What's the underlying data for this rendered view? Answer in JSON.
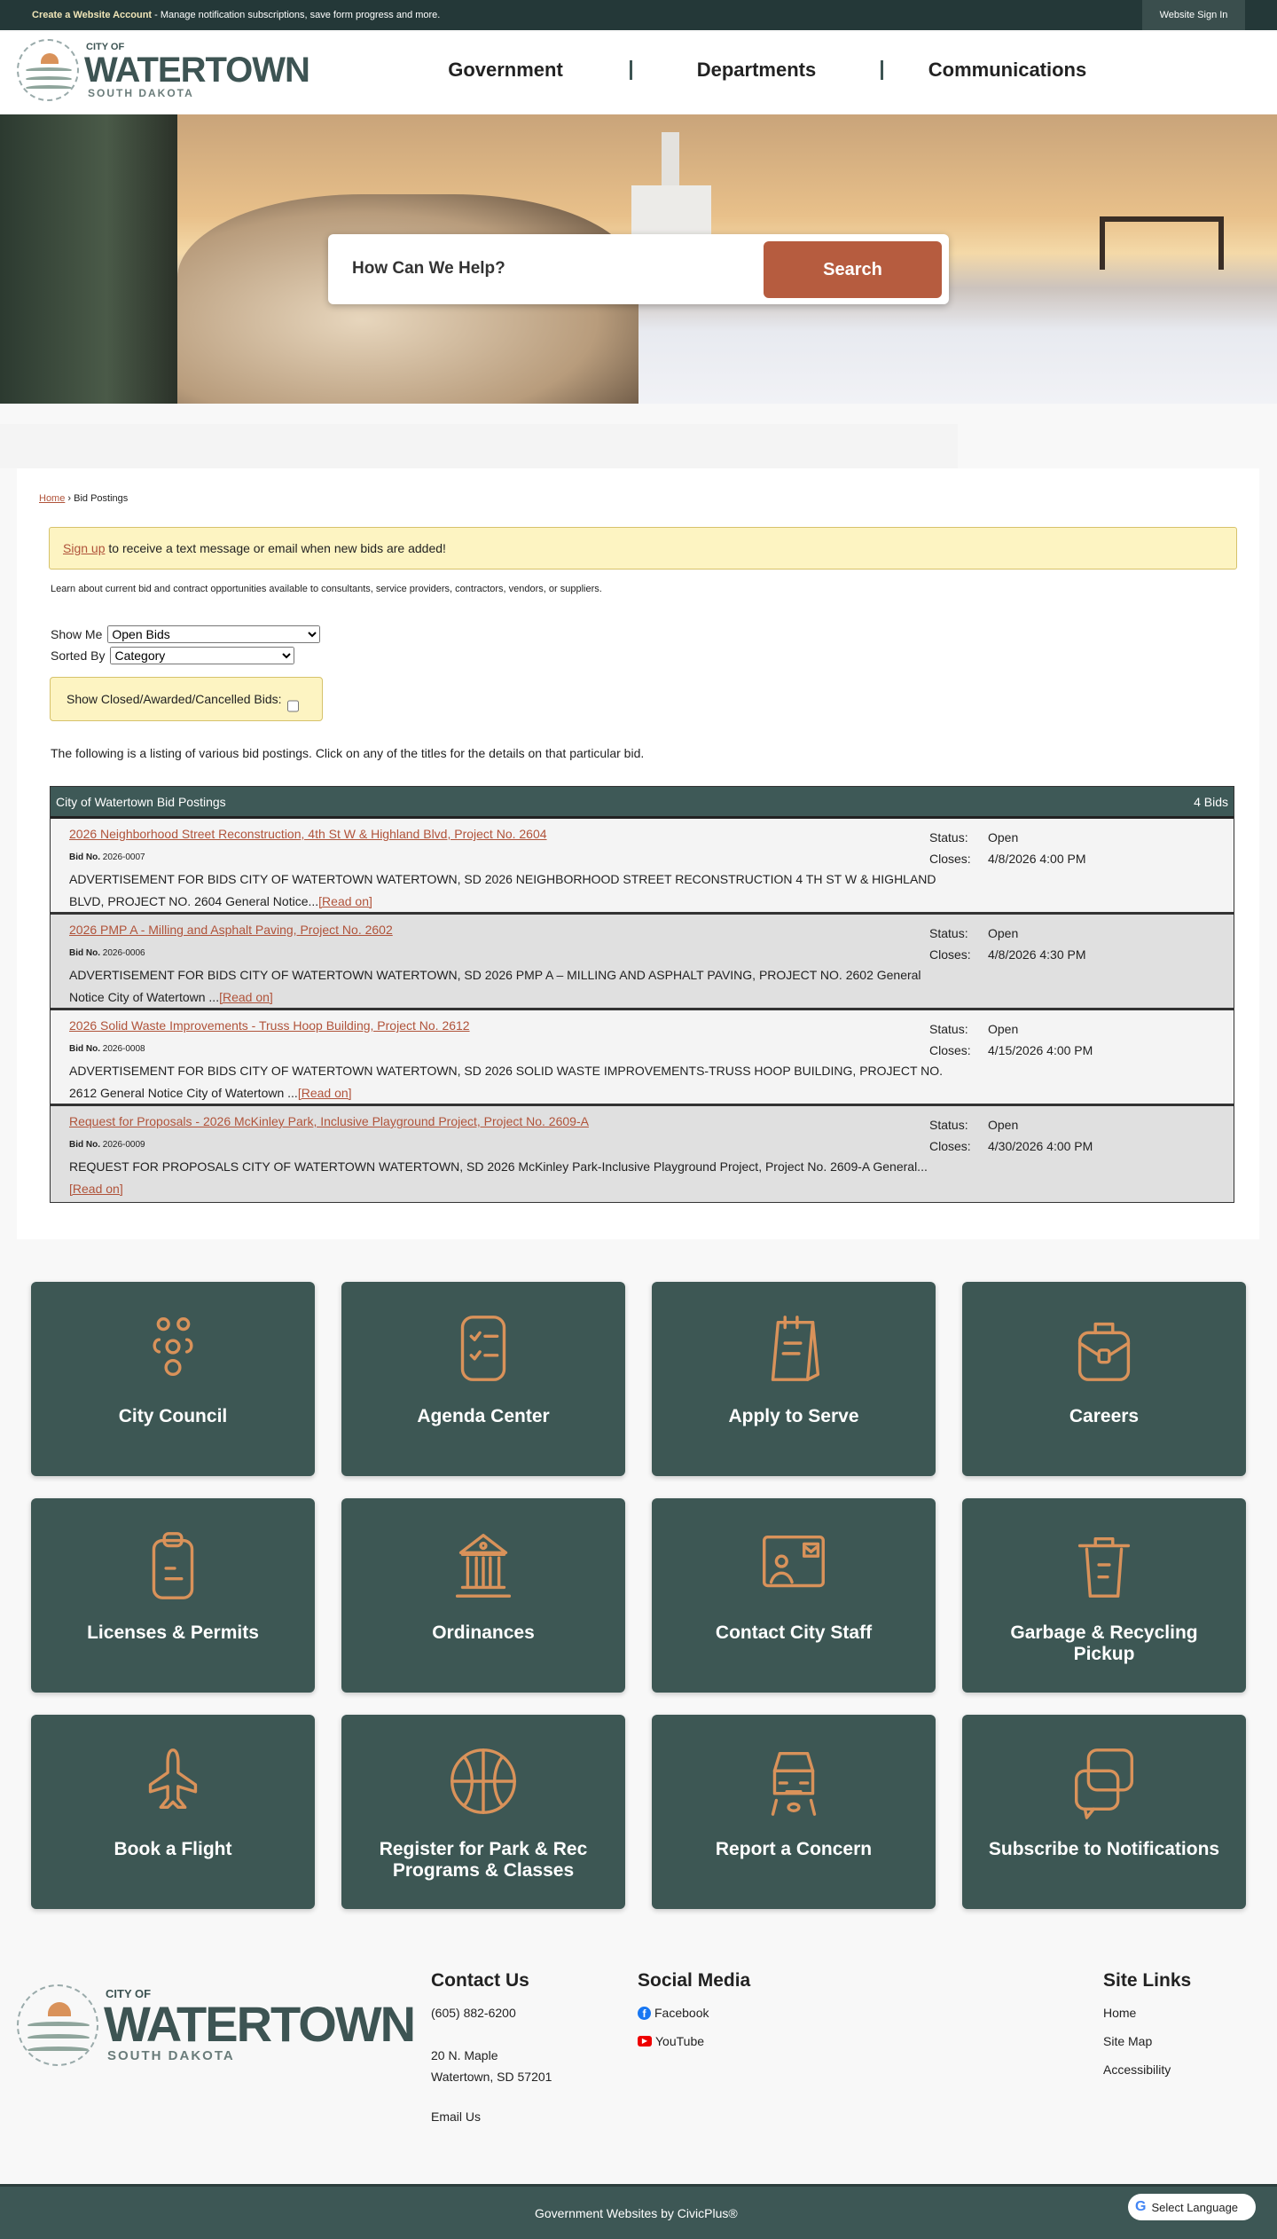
{
  "topbar": {
    "account_link": "Create a Website Account",
    "account_text": " - Manage notification subscriptions, save form progress and more.",
    "signin": "Website Sign In"
  },
  "logo": {
    "city_of": "CITY OF",
    "name": "WATERTOWN",
    "state": "SOUTH DAKOTA"
  },
  "nav": [
    "Government",
    "Departments",
    "Communications"
  ],
  "search": {
    "placeholder": "How Can We Help?",
    "button": "Search"
  },
  "breadcrumb": {
    "home": "Home",
    "sep": " › ",
    "current": "Bid Postings"
  },
  "alert": {
    "link": "Sign up",
    "text": " to receive a text message or email when new bids are added!"
  },
  "description": "Learn about current bid and contract opportunities available to consultants, service providers, contractors, vendors, or suppliers.",
  "filters": {
    "show_me_label": "Show Me",
    "show_me_value": "Open Bids",
    "sorted_by_label": "Sorted By",
    "sorted_by_value": "Category",
    "closed_label": "Show Closed/Awarded/Cancelled Bids:"
  },
  "listing_intro": "The following is a listing of various bid postings. Click on any of the titles for the details on that particular bid.",
  "table": {
    "title": "City of Watertown Bid Postings",
    "count": "4 Bids",
    "bid_no_label": "Bid No.",
    "status_label": "Status:",
    "closes_label": "Closes:",
    "read_on": "[Read on]",
    "rows": [
      {
        "title": "2026 Neighborhood Street Reconstruction, 4th St W & Highland Blvd, Project No. 2604",
        "bid_no": "2026-0007",
        "desc": "ADVERTISEMENT FOR BIDS CITY OF WATERTOWN WATERTOWN, SD 2026 NEIGHBORHOOD STREET RECONSTRUCTION 4 TH ST W & HIGHLAND BLVD, PROJECT NO. 2604 General Notice...",
        "status": "Open",
        "closes": "4/8/2026 4:00 PM"
      },
      {
        "title": "2026 PMP A - Milling and Asphalt Paving, Project No. 2602",
        "bid_no": "2026-0006",
        "desc": "ADVERTISEMENT FOR BIDS CITY OF WATERTOWN WATERTOWN, SD 2026 PMP A – MILLING AND ASPHALT PAVING, PROJECT NO. 2602 General Notice City of Watertown ...",
        "status": "Open",
        "closes": "4/8/2026 4:30 PM"
      },
      {
        "title": "2026 Solid Waste Improvements - Truss Hoop Building, Project No. 2612",
        "bid_no": "2026-0008",
        "desc": "ADVERTISEMENT FOR BIDS CITY OF WATERTOWN WATERTOWN, SD 2026 SOLID WASTE IMPROVEMENTS-TRUSS HOOP BUILDING, PROJECT NO. 2612 General Notice City of Watertown ...",
        "status": "Open",
        "closes": "4/15/2026 4:00 PM"
      },
      {
        "title": "Request for Proposals - 2026 McKinley Park, Inclusive Playground Project, Project No. 2609-A",
        "bid_no": "2026-0009",
        "desc": "REQUEST FOR PROPOSALS CITY OF WATERTOWN WATERTOWN, SD 2026 McKinley Park-Inclusive Playground Project, Project No. 2609-A General...",
        "status": "Open",
        "closes": "4/30/2026 4:00 PM"
      }
    ]
  },
  "tiles": [
    {
      "label": "City Council",
      "icon": "people-group-icon"
    },
    {
      "label": "Agenda Center",
      "icon": "checklist-icon"
    },
    {
      "label": "Apply to Serve",
      "icon": "notepad-icon"
    },
    {
      "label": "Careers",
      "icon": "briefcase-icon"
    },
    {
      "label": "Licenses & Permits",
      "icon": "clipboard-icon"
    },
    {
      "label": "Ordinances",
      "icon": "courthouse-icon"
    },
    {
      "label": "Contact City Staff",
      "icon": "contact-card-icon"
    },
    {
      "label": "Garbage & Recycling Pickup",
      "icon": "trash-can-icon"
    },
    {
      "label": "Book a Flight",
      "icon": "airplane-icon"
    },
    {
      "label": "Register for Park & Rec Programs & Classes",
      "icon": "basketball-icon"
    },
    {
      "label": "Report a Concern",
      "icon": "car-icon"
    },
    {
      "label": "Subscribe to Notifications",
      "icon": "chat-bubbles-icon"
    }
  ],
  "footer": {
    "contact": {
      "heading": "Contact Us",
      "phone": "(605) 882-6200",
      "address1": "20 N. Maple",
      "address2": "Watertown, SD 57201",
      "email": "Email Us"
    },
    "social": {
      "heading": "Social Media",
      "facebook": "Facebook",
      "youtube": "YouTube"
    },
    "links": {
      "heading": "Site Links",
      "items": [
        "Home",
        "Site Map",
        "Accessibility"
      ]
    },
    "credit": "Government Websites by CivicPlus®",
    "language": "Select Language"
  },
  "colors": {
    "brand": "#3d5754",
    "accent": "#b65c3f",
    "icon": "#d9925a"
  }
}
